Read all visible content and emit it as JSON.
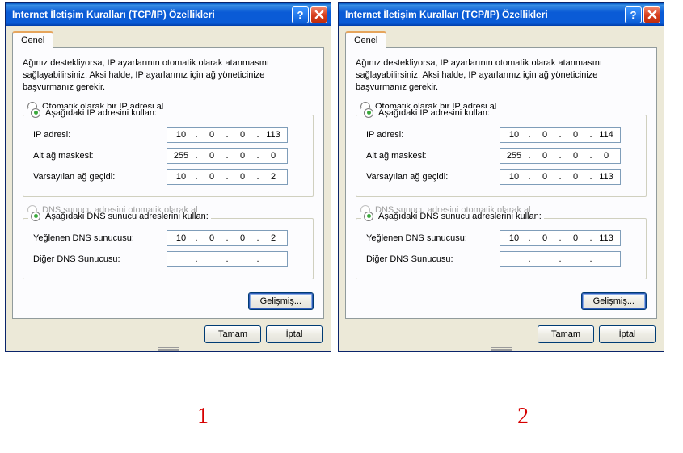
{
  "dialogs": [
    {
      "title": "Internet İletişim Kuralları (TCP/IP) Özellikleri",
      "tab": "Genel",
      "intro": "Ağınız destekliyorsa, IP ayarlarının otomatik olarak atanmasını sağlayabilirsiniz. Aksi halde, IP ayarlarınız için ağ yöneticinize başvurmanız gerekir.",
      "radio_auto_ip": "Otomatik olarak bir IP adresi al",
      "radio_use_ip": "Aşağıdaki IP adresini kullan:",
      "ip_label": "IP adresi:",
      "ip": [
        "10",
        "0",
        "0",
        "113"
      ],
      "mask_label": "Alt ağ maskesi:",
      "mask": [
        "255",
        "0",
        "0",
        "0"
      ],
      "gw_label": "Varsayılan ağ geçidi:",
      "gw": [
        "10",
        "0",
        "0",
        "2"
      ],
      "radio_auto_dns": "DNS sunucu adresini otomatik olarak al",
      "radio_use_dns": "Aşağıdaki DNS sunucu adreslerini kullan:",
      "dns1_label": "Yeğlenen DNS sunucusu:",
      "dns1": [
        "10",
        "0",
        "0",
        "2"
      ],
      "dns2_label": "Diğer DNS Sunucusu:",
      "dns2": [
        "",
        "",
        "",
        ""
      ],
      "advanced": "Gelişmiş...",
      "ok": "Tamam",
      "cancel": "İptal",
      "figure": "1"
    },
    {
      "title": "Internet İletişim Kuralları (TCP/IP) Özellikleri",
      "tab": "Genel",
      "intro": "Ağınız destekliyorsa, IP ayarlarının otomatik olarak atanmasını sağlayabilirsiniz. Aksi halde, IP ayarlarınız için ağ yöneticinize başvurmanız gerekir.",
      "radio_auto_ip": "Otomatik olarak bir IP adresi al",
      "radio_use_ip": "Aşağıdaki IP adresini kullan:",
      "ip_label": "IP adresi:",
      "ip": [
        "10",
        "0",
        "0",
        "114"
      ],
      "mask_label": "Alt ağ maskesi:",
      "mask": [
        "255",
        "0",
        "0",
        "0"
      ],
      "gw_label": "Varsayılan ağ geçidi:",
      "gw": [
        "10",
        "0",
        "0",
        "113"
      ],
      "radio_auto_dns": "DNS sunucu adresini otomatik olarak al",
      "radio_use_dns": "Aşağıdaki DNS sunucu adreslerini kullan:",
      "dns1_label": "Yeğlenen DNS sunucusu:",
      "dns1": [
        "10",
        "0",
        "0",
        "113"
      ],
      "dns2_label": "Diğer DNS Sunucusu:",
      "dns2": [
        "",
        "",
        "",
        ""
      ],
      "advanced": "Gelişmiş...",
      "ok": "Tamam",
      "cancel": "İptal",
      "figure": "2"
    }
  ],
  "icons": {
    "help": "?",
    "close": "×"
  }
}
